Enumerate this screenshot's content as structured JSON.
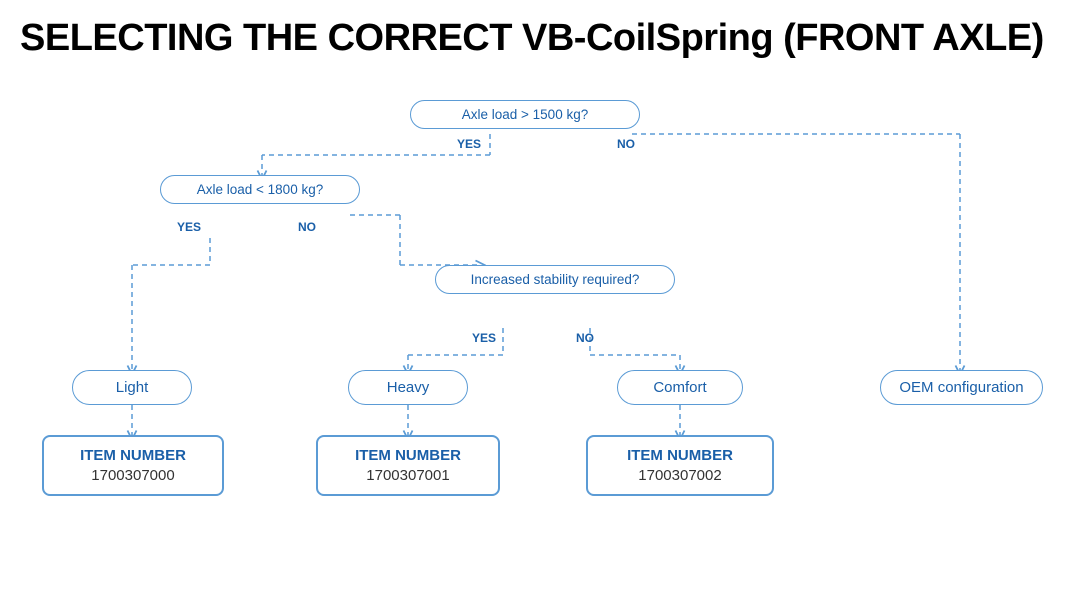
{
  "title": "SELECTING THE CORRECT VB-CoilSpring (FRONT AXLE)",
  "diagram": {
    "decision1": {
      "label": "Axle load > 1500 kg?",
      "yes": "YES",
      "no": "NO"
    },
    "decision2": {
      "label": "Axle load < 1800 kg?",
      "yes": "YES",
      "no": "NO"
    },
    "decision3": {
      "label": "Increased stability required?",
      "yes": "YES",
      "no": "NO"
    },
    "results": {
      "light": "Light",
      "heavy": "Heavy",
      "comfort": "Comfort",
      "oem": "OEM configuration"
    },
    "items": {
      "item0": {
        "label": "ITEM NUMBER",
        "number": "1700307000"
      },
      "item1": {
        "label": "ITEM NUMBER",
        "number": "1700307001"
      },
      "item2": {
        "label": "ITEM NUMBER",
        "number": "1700307002"
      }
    }
  }
}
